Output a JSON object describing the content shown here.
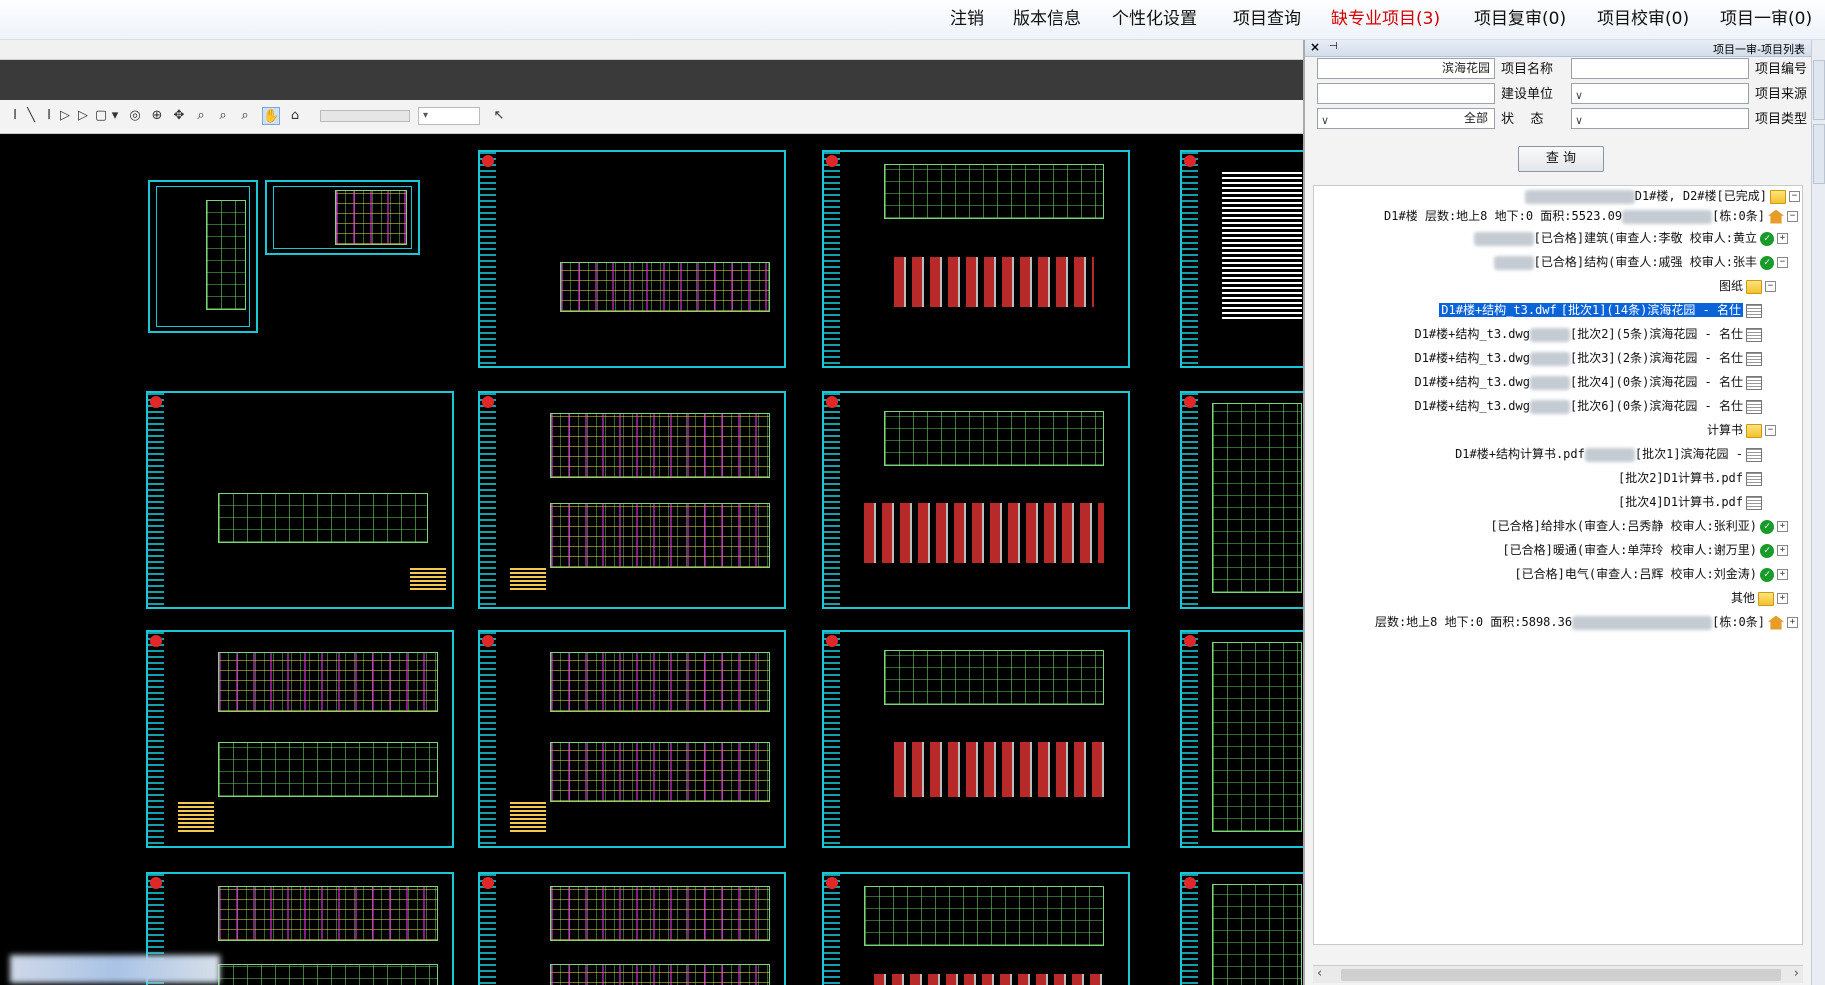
{
  "menu": {
    "items": [
      "项目一审(0)",
      "项目校审(0)",
      "项目复审(0)",
      "缺专业项目(3)",
      "项目查询",
      "个性化设置",
      "版本信息",
      "注销"
    ],
    "highlight_color": "#d40000"
  },
  "viewer": {
    "toolbar_icons": [
      "text-icon",
      "line-icon",
      "text-icon",
      "play-icon",
      "play-icon",
      "stop-icon",
      "dropdown-icon",
      "target-icon",
      "orbit-icon",
      "pan-icon",
      "zoom-window-icon",
      "zoom-extents-icon",
      "zoom-icon",
      "hand-icon",
      "home-icon"
    ],
    "accent": "#19c7d6"
  },
  "panel": {
    "title": "项目一审-项目列表",
    "close_glyph": "×",
    "pin_glyph": "⊣",
    "labels": {
      "project_no": "项目编号",
      "project_name": "项目名称",
      "project_source": "项目来源",
      "build_unit": "建设单位",
      "project_type": "项目类型",
      "status": "状    态"
    },
    "fields": {
      "project_no": "",
      "project_name": "滨海花园",
      "project_source": "",
      "build_unit": "",
      "project_type": "",
      "status": "全部"
    },
    "query_button": "查 询"
  },
  "tree": {
    "root": "[已完成]",
    "root_suffix": "D1#楼, D2#楼",
    "b1": "[栋:0条]",
    "b1_suffix": "D1#楼  层数:地上8 地下:0 面积:5523.09",
    "b2": "[栋:0条]",
    "b2_suffix": "层数:地上8 地下:0 面积:5898.36",
    "disciplines": [
      {
        "text": "[已合格]建筑(审查人:李敬  校审人:黄立",
        "state": "ok"
      },
      {
        "text": "[已合格]结构(审查人:戚强  校审人:张丰",
        "state": "ok"
      }
    ],
    "drawings_folder": "图纸",
    "drawings": [
      "[批次1](14条)滨海花园 - 名仕",
      "[批次2](5条)滨海花园 - 名仕",
      "[批次3](2条)滨海花园 - 名仕",
      "[批次4](0条)滨海花园 - 名仕",
      "[批次6](0条)滨海花园 - 名仕"
    ],
    "drawing_tails": [
      "D1#楼+结构_t3.dwf",
      "D1#楼+结构_t3.dwg",
      "D1#楼+结构_t3.dwg",
      "D1#楼+结构_t3.dwg",
      "D1#楼+结构_t3.dwg"
    ],
    "calc_folder": "计算书",
    "calcs": [
      "[批次1]滨海花园 -",
      "[批次2]D1计算书.pdf",
      "[批次4]D1计算书.pdf"
    ],
    "calc1_tail": "D1#楼+结构计算书.pdf",
    "other_disciplines": [
      "[已合格]给排水(审查人:吕秀静  校审人:张利亚)",
      "[已合格]暖通(审查人:单萍玲  校审人:谢万里)",
      "[已合格]电气(审查人:吕辉  校审人:刘金涛)"
    ],
    "other_folder": "其他"
  }
}
